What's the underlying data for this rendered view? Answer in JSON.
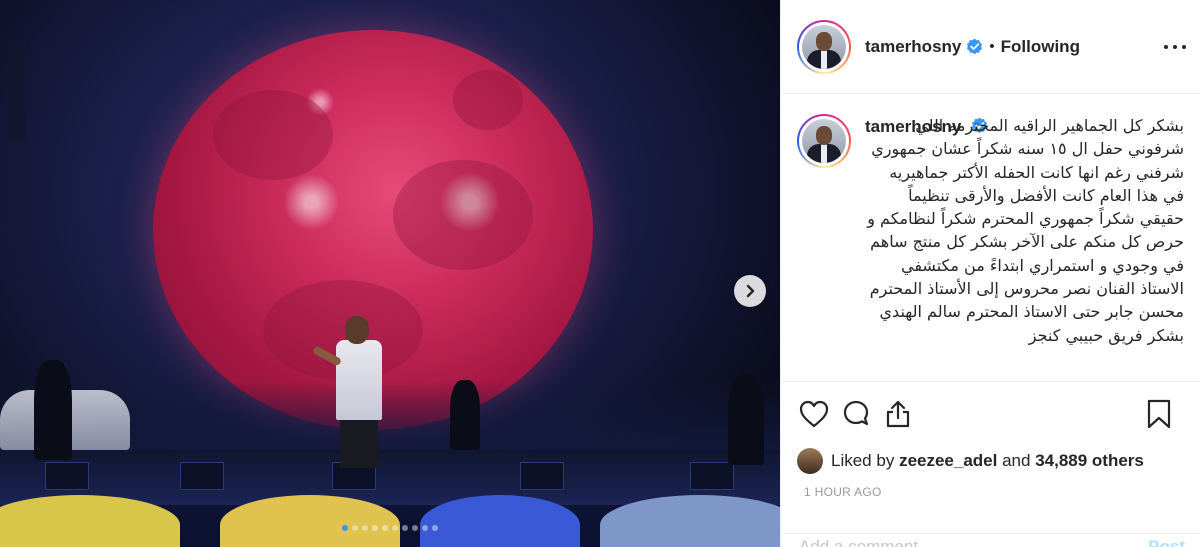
{
  "post": {
    "username": "tamerhosny",
    "separator": "•",
    "follow_status": "Following",
    "caption_body": "بشكر كل الجماهير الراقيه المحترمه اللي شرفوني حفل ال ١٥ سنه شكراً عشان جمهوري شرفني رغم انها كانت الحفله الأكتر جماهيريه في هذا العام كانت الأفضل والأرقى تنظيماً حقيقي شكراً جمهوري المحترم شكراً لنظامكم و حرص كل منكم على الآخر بشكر كل منتج ساهم في وجودي و استمراري ابتداءً من مكتشفي الاستاذ الفنان نصر محروس إلى الأستاذ المحترم محسن جابر حتى الاستاذ المحترم سالم الهندي بشكر فريق حبيبي كنجز",
    "likes": {
      "prefix": "Liked by",
      "user": "zeezee_adel",
      "and": "and",
      "others": "34,889 others"
    },
    "timestamp": "1 HOUR AGO",
    "comment_placeholder": "Add a comment…",
    "post_button": "Post"
  },
  "carousel": {
    "total_slides": 10,
    "active_slide": 1
  },
  "icons": {
    "verified": "verified-badge-icon",
    "more": "more-options-icon",
    "like": "heart-icon",
    "comment": "comment-icon",
    "share": "share-icon",
    "save": "bookmark-icon",
    "next": "chevron-right-icon"
  },
  "colors": {
    "verified_blue": "#3897f0",
    "text": "#262626",
    "muted": "#999999",
    "border": "#efefef"
  }
}
